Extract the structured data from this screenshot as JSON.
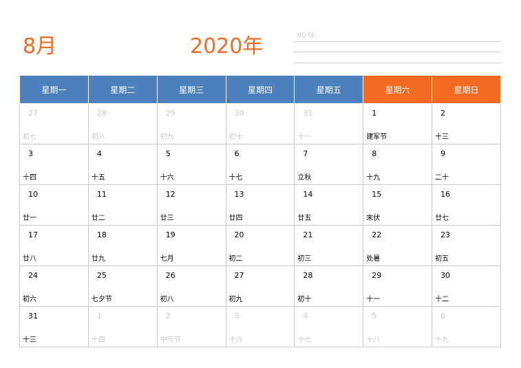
{
  "header": {
    "month": "8月",
    "year": "2020年",
    "note_label": "NOTE:"
  },
  "colors": {
    "weekday_header": "#4d80bf",
    "weekend_header": "#f26b21",
    "title": "#f26b21"
  },
  "weekdays": [
    "星期一",
    "星期二",
    "星期三",
    "星期四",
    "星期五",
    "星期六",
    "星期日"
  ],
  "weeks": [
    [
      {
        "d": "27",
        "l": "初七",
        "o": true
      },
      {
        "d": "28",
        "l": "初八",
        "o": true
      },
      {
        "d": "29",
        "l": "初九",
        "o": true
      },
      {
        "d": "30",
        "l": "初十",
        "o": true
      },
      {
        "d": "31",
        "l": "十一",
        "o": true
      },
      {
        "d": "1",
        "l": "建军节",
        "o": false
      },
      {
        "d": "2",
        "l": "十三",
        "o": false
      }
    ],
    [
      {
        "d": "3",
        "l": "十四",
        "o": false
      },
      {
        "d": "4",
        "l": "十五",
        "o": false
      },
      {
        "d": "5",
        "l": "十六",
        "o": false
      },
      {
        "d": "6",
        "l": "十七",
        "o": false
      },
      {
        "d": "7",
        "l": "立秋",
        "o": false
      },
      {
        "d": "8",
        "l": "十九",
        "o": false
      },
      {
        "d": "9",
        "l": "二十",
        "o": false
      }
    ],
    [
      {
        "d": "10",
        "l": "廿一",
        "o": false
      },
      {
        "d": "11",
        "l": "廿二",
        "o": false
      },
      {
        "d": "12",
        "l": "廿三",
        "o": false
      },
      {
        "d": "13",
        "l": "廿四",
        "o": false
      },
      {
        "d": "14",
        "l": "廿五",
        "o": false
      },
      {
        "d": "15",
        "l": "末伏",
        "o": false
      },
      {
        "d": "16",
        "l": "廿七",
        "o": false
      }
    ],
    [
      {
        "d": "17",
        "l": "廿八",
        "o": false
      },
      {
        "d": "18",
        "l": "廿九",
        "o": false
      },
      {
        "d": "19",
        "l": "七月",
        "o": false
      },
      {
        "d": "20",
        "l": "初二",
        "o": false
      },
      {
        "d": "21",
        "l": "初三",
        "o": false
      },
      {
        "d": "22",
        "l": "处暑",
        "o": false
      },
      {
        "d": "23",
        "l": "初五",
        "o": false
      }
    ],
    [
      {
        "d": "24",
        "l": "初六",
        "o": false
      },
      {
        "d": "25",
        "l": "七夕节",
        "o": false
      },
      {
        "d": "26",
        "l": "初八",
        "o": false
      },
      {
        "d": "27",
        "l": "初九",
        "o": false
      },
      {
        "d": "28",
        "l": "初十",
        "o": false
      },
      {
        "d": "29",
        "l": "十一",
        "o": false
      },
      {
        "d": "30",
        "l": "十二",
        "o": false
      }
    ],
    [
      {
        "d": "31",
        "l": "十三",
        "o": false
      },
      {
        "d": "1",
        "l": "十四",
        "o": true
      },
      {
        "d": "2",
        "l": "中元节",
        "o": true
      },
      {
        "d": "3",
        "l": "十六",
        "o": true
      },
      {
        "d": "4",
        "l": "十七",
        "o": true
      },
      {
        "d": "5",
        "l": "十八",
        "o": true
      },
      {
        "d": "6",
        "l": "十九",
        "o": true
      }
    ]
  ]
}
